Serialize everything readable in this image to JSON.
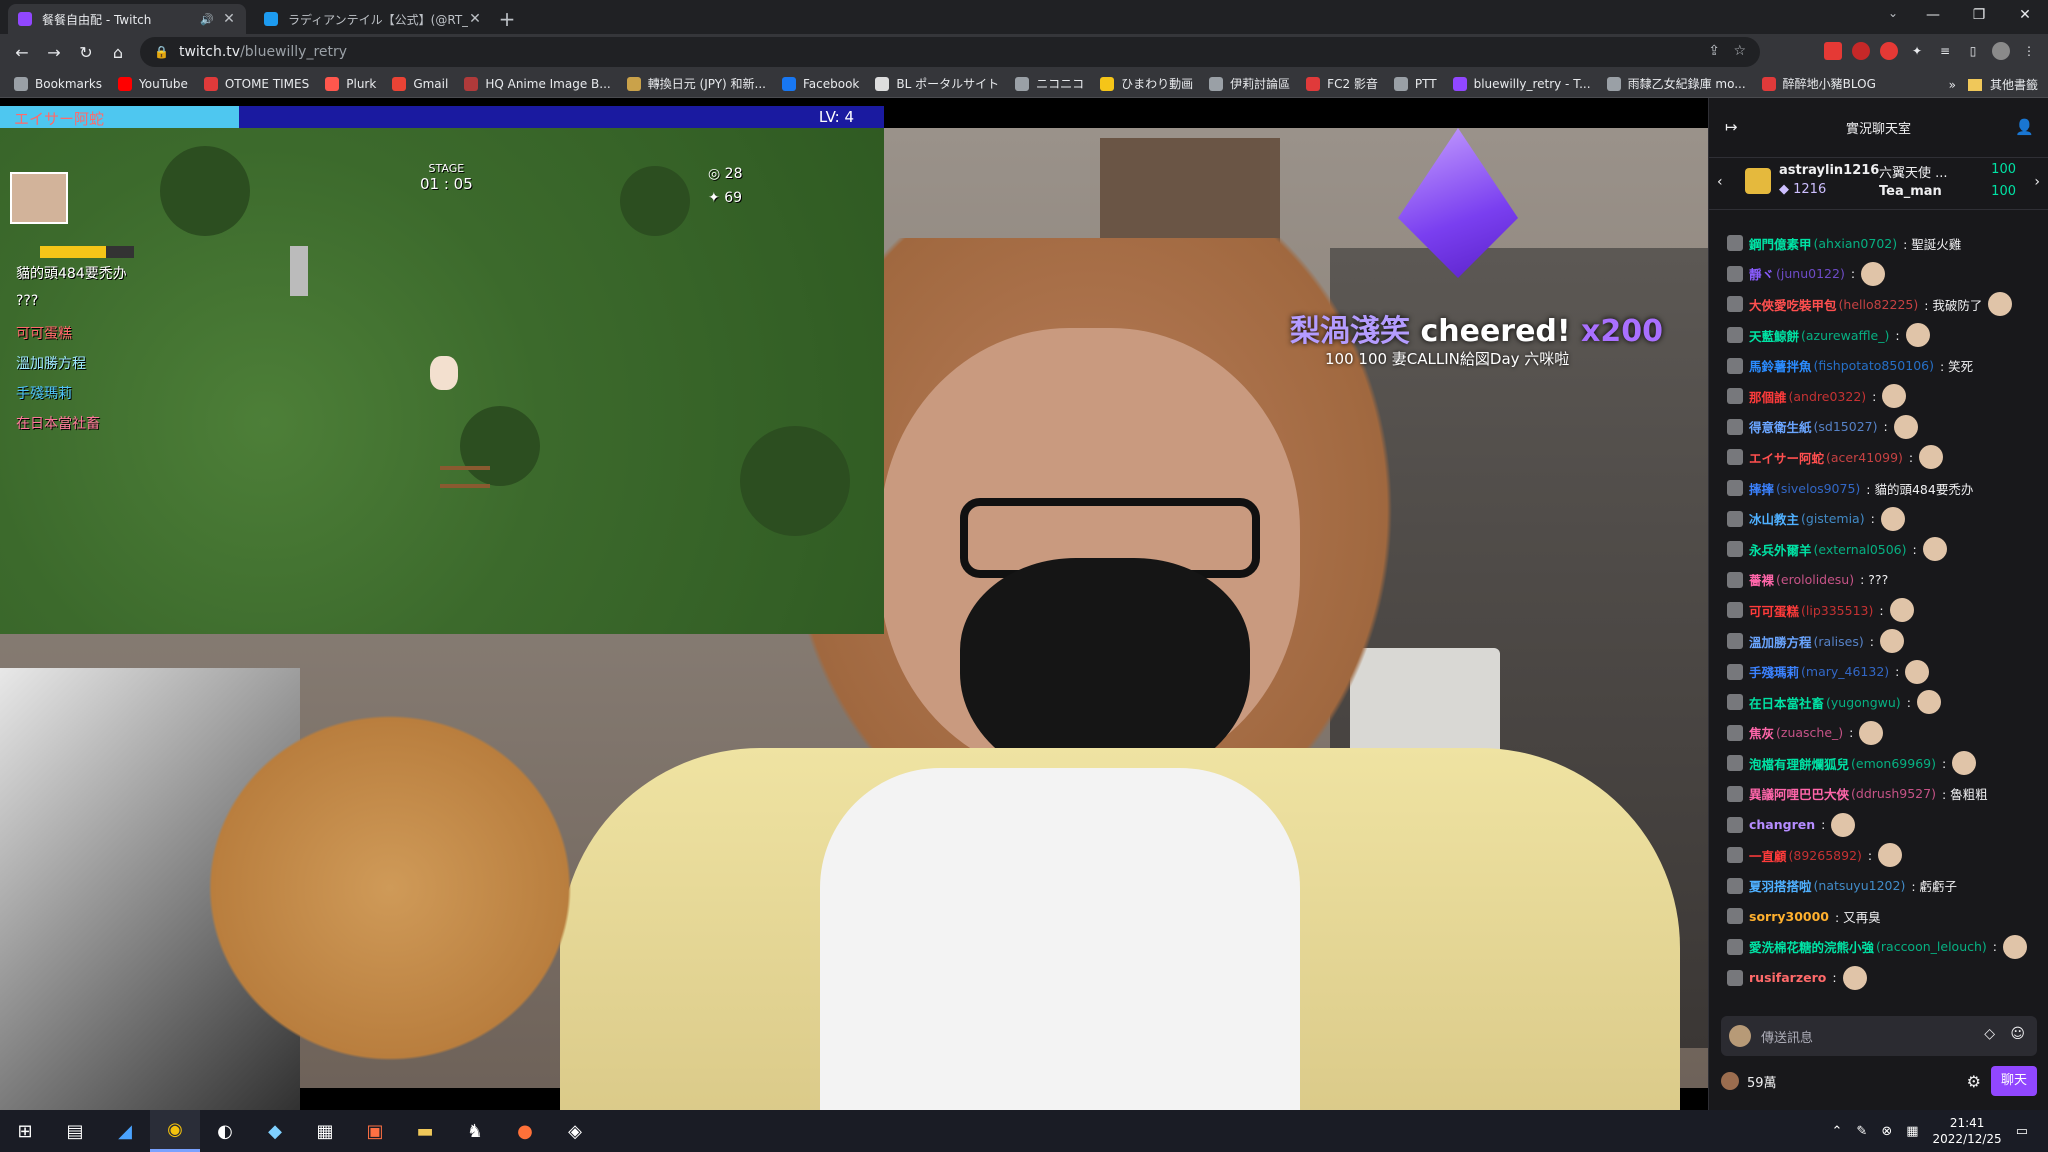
{
  "browser": {
    "tabs": [
      {
        "title": "餐餐自由配 - Twitch",
        "active": true,
        "fav_color": "#9147ff",
        "has_sound": true
      },
      {
        "title": "ラディアンテイル【公式】(@RT_x_inf",
        "active": false,
        "fav_color": "#1d9bf0",
        "has_sound": false
      }
    ],
    "url_host": "twitch.tv",
    "url_path": "/bluewilly_retry",
    "bookmarks": [
      {
        "label": "Bookmarks",
        "color": "#9aa0a6"
      },
      {
        "label": "YouTube",
        "color": "#ff0000"
      },
      {
        "label": "OTOME TIMES",
        "color": "#e03a3a"
      },
      {
        "label": "Plurk",
        "color": "#ff574d"
      },
      {
        "label": "Gmail",
        "color": "#ea4335"
      },
      {
        "label": "HQ Anime Image B...",
        "color": "#b03a3a"
      },
      {
        "label": "轉換日元 (JPY) 和新...",
        "color": "#caa24a"
      },
      {
        "label": "Facebook",
        "color": "#1877f2"
      },
      {
        "label": "BL ポータルサイト",
        "color": "#dddddd"
      },
      {
        "label": "ニコニコ",
        "color": "#9aa0a6"
      },
      {
        "label": "ひまわり動画",
        "color": "#f5c518"
      },
      {
        "label": "伊莉討論區",
        "color": "#9aa0a6"
      },
      {
        "label": "FC2 影音",
        "color": "#e03a3a"
      },
      {
        "label": "PTT",
        "color": "#9aa0a6"
      },
      {
        "label": "bluewilly_retry - T...",
        "color": "#9147ff"
      },
      {
        "label": "雨隸乙女紀錄庫 mo...",
        "color": "#9aa0a6"
      },
      {
        "label": "醉醉地小豬BLOG",
        "color": "#e03a3a"
      }
    ],
    "other_bookmarks": "其他書籤"
  },
  "game": {
    "player_name": "エイサー阿蛇",
    "level": "LV: 4",
    "stage_label": "STAGE",
    "stage_time": "01 : 05",
    "count_a": "28",
    "count_b": "69",
    "hp_fraction": 0.27,
    "chat": [
      {
        "text": "貓的頭484要禿办",
        "color": "#ffffff"
      },
      {
        "text": "???",
        "color": "#ffffff"
      },
      {
        "text": "可可蛋糕",
        "color": "#ff6a6a"
      },
      {
        "text": "溫加勝方程",
        "color": "#9fe8ff"
      },
      {
        "text": "手殘瑪莉",
        "color": "#4fc3f7"
      },
      {
        "text": "在日本當社畜",
        "color": "#ff7a9a"
      }
    ]
  },
  "cheer": {
    "name": "梨渦淺笑",
    "verb": "cheered!",
    "amount": "x200",
    "sub": "100  100  妻CALLIN給図Day 六咪啦"
  },
  "chat": {
    "title": "實況聊天室",
    "leader": {
      "user1": "astraylin1216",
      "count1": "1216",
      "user2": "六翼天使 ...",
      "v2": "100",
      "user3": "Tea_man",
      "v3": "100"
    },
    "messages": [
      {
        "user": "鋼門億素甲",
        "login": "(ahxian0702)",
        "text": ": 聖誕火雞",
        "color": "#00e2a4",
        "emote": false
      },
      {
        "user": "靜ヾ",
        "login": "(junu0122)",
        "text": ":",
        "color": "#8a5cff",
        "emote": true
      },
      {
        "user": "大俠愛吃裝甲包",
        "login": "(hello82225)",
        "text": ": 我破防了",
        "color": "#ff4f4f",
        "emote": true
      },
      {
        "user": "天藍鯨餅",
        "login": "(azurewaffle_)",
        "text": ":",
        "color": "#00e2a4",
        "emote": true
      },
      {
        "user": "馬鈴薯拌魚",
        "login": "(fishpotato850106)",
        "text": ": 笑死",
        "color": "#2b8cff",
        "emote": false
      },
      {
        "user": "那個誰",
        "login": "(andre0322)",
        "text": ":",
        "color": "#ff3b3b",
        "emote": true
      },
      {
        "user": "得意衛生紙",
        "login": "(sd15027)",
        "text": ":",
        "color": "#6aa5ff",
        "emote": true
      },
      {
        "user": "エイサー阿蛇",
        "login": "(acer41099)",
        "text": ":",
        "color": "#ff4f4f",
        "emote": true
      },
      {
        "user": "摔摔",
        "login": "(sivelos9075)",
        "text": ": 貓的頭484要禿办",
        "color": "#3b82ff",
        "emote": false
      },
      {
        "user": "冰山教主",
        "login": "(gistemia)",
        "text": ":",
        "color": "#4fb0ff",
        "emote": true
      },
      {
        "user": "永兵外爾羊",
        "login": "(external0506)",
        "text": ":",
        "color": "#00e2a4",
        "emote": true
      },
      {
        "user": "薔裸",
        "login": "(erololidesu)",
        "text": ": ???",
        "color": "#ff66aa",
        "emote": false
      },
      {
        "user": "可可蛋糕",
        "login": "(lip335513)",
        "text": ":",
        "color": "#ff3b3b",
        "emote": true
      },
      {
        "user": "溫加勝方程",
        "login": "(ralises)",
        "text": ":",
        "color": "#6aa5ff",
        "emote": true
      },
      {
        "user": "手殘瑪莉",
        "login": "(mary_46132)",
        "text": ":",
        "color": "#3b82ff",
        "emote": true
      },
      {
        "user": "在日本當社畜",
        "login": "(yugongwu)",
        "text": ":",
        "color": "#00e2a4",
        "emote": true
      },
      {
        "user": "焦灰",
        "login": "(zuasche_)",
        "text": ":",
        "color": "#ff66aa",
        "emote": true
      },
      {
        "user": "泡檔有理餅爛狐兒",
        "login": "(emon69969)",
        "text": ":",
        "color": "#00e2a4",
        "emote": true
      },
      {
        "user": "異議阿哩巴巴大俠",
        "login": "(ddrush9527)",
        "text": ": 魯粗粗",
        "color": "#ff66aa",
        "emote": false
      },
      {
        "user": "changren",
        "login": "",
        "text": ":",
        "color": "#b58cff",
        "emote": true
      },
      {
        "user": "一直顧",
        "login": "(89265892)",
        "text": ":",
        "color": "#ff3b3b",
        "emote": true
      },
      {
        "user": "夏羽搭搭啦",
        "login": "(natsuyu1202)",
        "text": ": 虧虧子",
        "color": "#4fb0ff",
        "emote": false
      },
      {
        "user": "sorry30000",
        "login": "",
        "text": ": 又再臭",
        "color": "#ffb02e",
        "emote": false
      },
      {
        "user": "愛洗棉花糖的浣熊小強",
        "login": "(raccoon_lelouch)",
        "text": ":",
        "color": "#00e2a4",
        "emote": true
      },
      {
        "user": "rusifarzero",
        "login": "",
        "text": ":",
        "color": "#ff6a6a",
        "emote": true
      }
    ],
    "input_placeholder": "傳送訊息",
    "points": "59萬",
    "send_label": "聊天"
  },
  "taskbar": {
    "time": "21:41",
    "date": "2022/12/25"
  }
}
